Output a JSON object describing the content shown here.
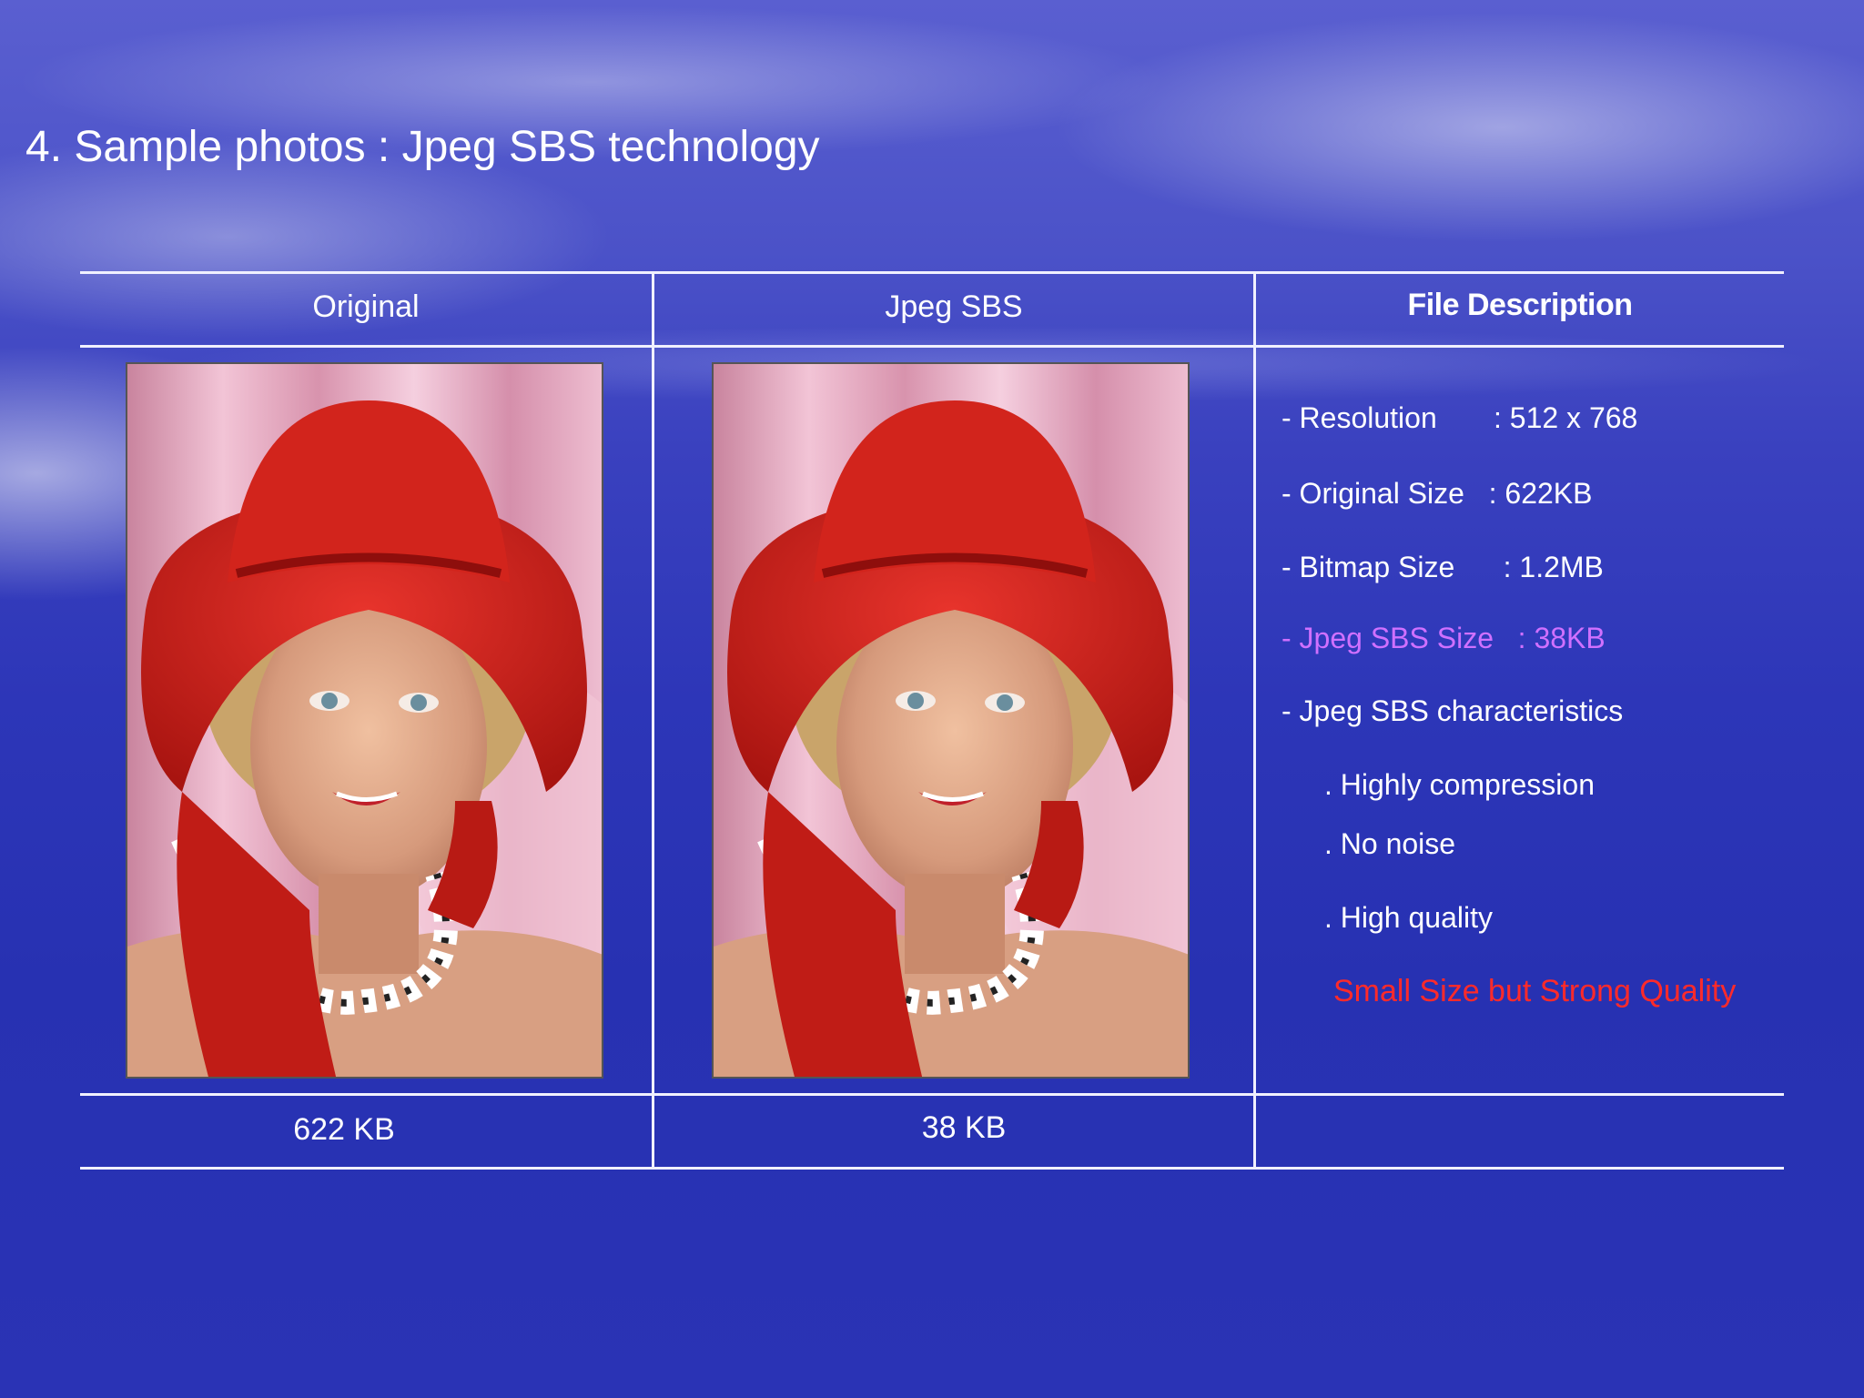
{
  "title": "4. Sample photos : Jpeg SBS technology",
  "table": {
    "headers": [
      "Original",
      "Jpeg SBS",
      "File Description"
    ],
    "footer": [
      "622 KB",
      "38 KB",
      ""
    ]
  },
  "description": {
    "resolution": "- Resolution       : 512 x 768",
    "original_size": "- Original Size   : 622KB",
    "bitmap_size": "- Bitmap Size      : 1.2MB",
    "sbs_size": "- Jpeg SBS Size   : 38KB",
    "characteristics": "- Jpeg SBS characteristics",
    "items": [
      ". Highly compression",
      ". No noise",
      ". High quality"
    ],
    "note": "Small Size but Strong Quality"
  },
  "colors": {
    "highlight": "#d070ff",
    "note": "#ff2a2a",
    "lines": "#f0f0ff"
  }
}
